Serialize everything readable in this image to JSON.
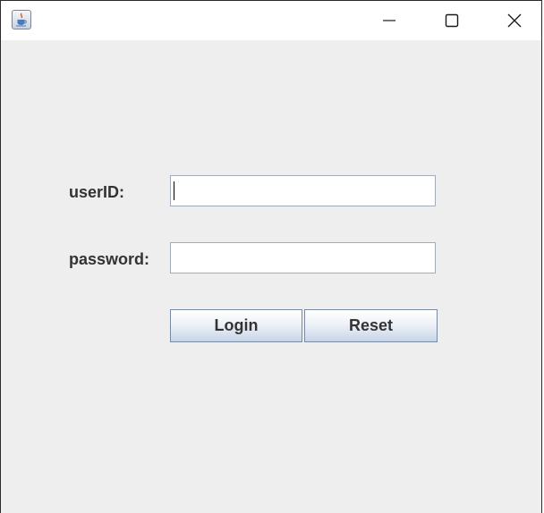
{
  "window": {
    "icon": "java-cup-icon",
    "controls": [
      "minimize-icon",
      "maximize-icon",
      "close-icon"
    ]
  },
  "form": {
    "userid_label": "userID:",
    "userid_value": "",
    "password_label": "password:",
    "password_value": "",
    "login_label": "Login",
    "reset_label": "Reset"
  },
  "colors": {
    "background": "#eeeeee",
    "titlebar": "#ffffff",
    "label_text": "#333333",
    "button_border": "#7a8aa1"
  }
}
